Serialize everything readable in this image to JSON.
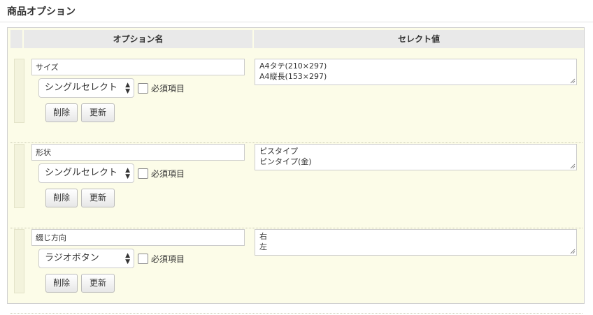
{
  "section": {
    "title": "商品オプション"
  },
  "table": {
    "headers": {
      "name": "オプション名",
      "value": "セレクト値"
    }
  },
  "required_label": "必須項目",
  "buttons": {
    "delete": "削除",
    "update": "更新"
  },
  "options": [
    {
      "name": "サイズ",
      "type": "シングルセレクト",
      "required": false,
      "values": [
        "A4タテ(210×297)",
        "A4縦長(153×297)"
      ]
    },
    {
      "name": "形状",
      "type": "シングルセレクト",
      "required": false,
      "values": [
        "ピスタイプ",
        "ピンタイプ(金)"
      ]
    },
    {
      "name": "綴じ方向",
      "type": "ラジオボタン",
      "required": false,
      "values": [
        "右",
        "左"
      ]
    }
  ]
}
